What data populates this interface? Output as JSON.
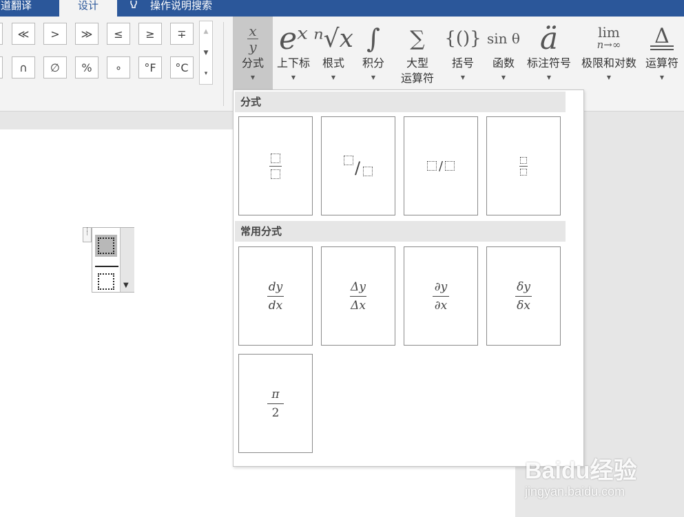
{
  "tabs": {
    "translate": "有道翻译",
    "design": "设计",
    "tell_me": "操作说明搜索"
  },
  "symbols": {
    "row1": [
      "≪",
      ">",
      "≫",
      "≤",
      "≥",
      "∓"
    ],
    "row2": [
      "∩",
      "∅",
      "%",
      "∘",
      "°F",
      "°C"
    ]
  },
  "tools": {
    "fraction": "分式",
    "script": "上下标",
    "radical": "根式",
    "integral": "积分",
    "large_op_1": "大型",
    "large_op_2": "运算符",
    "bracket": "括号",
    "function": "函数",
    "accent": "标注符号",
    "limit_log": "极限和对数",
    "operator": "运算符"
  },
  "glyphs": {
    "script": "eˣ",
    "radical": "ⁿ√x",
    "integral": "∫",
    "bracket": "{()}",
    "function": "sin θ",
    "accent": "ä",
    "limit": "lim",
    "limit_sub": "n→∞",
    "operator": "Δ"
  },
  "dropdown": {
    "section_fraction": "分式",
    "section_common": "常用分式",
    "common": [
      {
        "num": "dy",
        "den": "dx"
      },
      {
        "num": "Δy",
        "den": "Δx"
      },
      {
        "num": "∂y",
        "den": "∂x"
      },
      {
        "num": "δy",
        "den": "δx"
      },
      {
        "num": "π",
        "den": "2"
      }
    ]
  },
  "watermark": {
    "brand": "Baidu经验",
    "url": "jingyan.baidu.com"
  }
}
